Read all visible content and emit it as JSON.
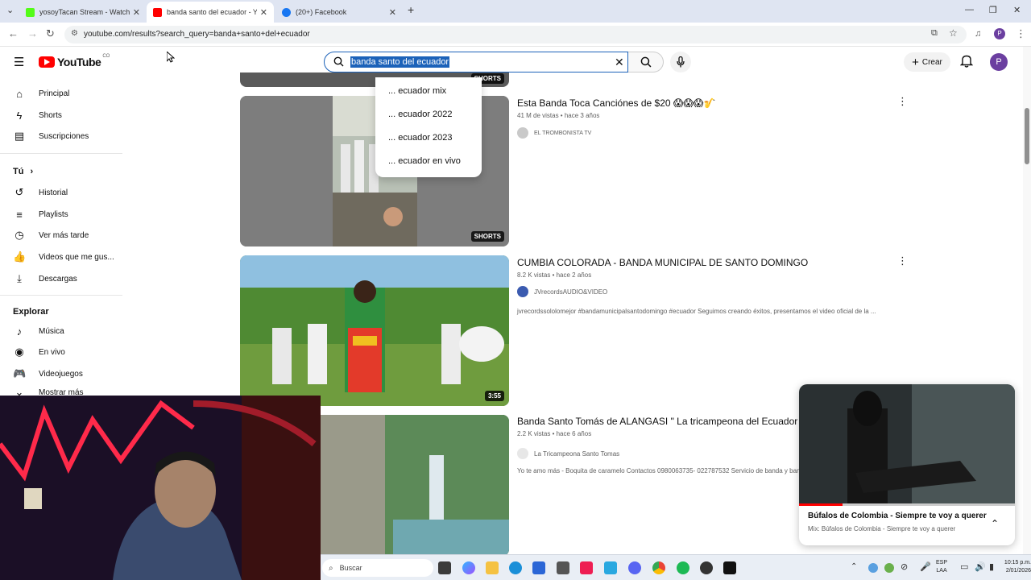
{
  "browser": {
    "tabs": [
      {
        "title": "yosoyTacan Stream - Watch Liv",
        "fav_color": "#53fc18"
      },
      {
        "title": "banda santo del ecuador - You",
        "fav_color": "#ff0000"
      },
      {
        "title": "(20+) Facebook",
        "fav_color": "#1877f2"
      }
    ],
    "url": "youtube.com/results?search_query=banda+santo+del+ecuador",
    "profile_initial": "P"
  },
  "youtube": {
    "logo_text": "YouTube",
    "region": "CO",
    "search_query": "banda santo del ecuador",
    "create_label": "Crear",
    "avatar_initial": "P",
    "suggestions": [
      "... ecuador mix",
      "... ecuador 2022",
      "... ecuador 2023",
      "... ecuador en vivo"
    ]
  },
  "sidebar": {
    "main": [
      {
        "label": "Principal",
        "icon": "home-icon"
      },
      {
        "label": "Shorts",
        "icon": "shorts-icon"
      },
      {
        "label": "Suscripciones",
        "icon": "subscriptions-icon"
      }
    ],
    "you_heading": "Tú",
    "you": [
      {
        "label": "Historial",
        "icon": "history-icon"
      },
      {
        "label": "Playlists",
        "icon": "playlists-icon"
      },
      {
        "label": "Ver más tarde",
        "icon": "watch-later-icon"
      },
      {
        "label": "Videos que me gus...",
        "icon": "like-icon"
      },
      {
        "label": "Descargas",
        "icon": "download-icon"
      }
    ],
    "explore_heading": "Explorar",
    "explore": [
      {
        "label": "Música",
        "icon": "music-icon"
      },
      {
        "label": "En vivo",
        "icon": "live-icon"
      },
      {
        "label": "Videojuegos",
        "icon": "gaming-icon"
      }
    ],
    "more_label": "Mostrar más"
  },
  "results": [
    {
      "title": "Esta Banda Toca Canciónes de $20 😱😱😱🎷",
      "meta": "41 M de vistas • hace 3 años",
      "channel": "EL TROMBONISTA TV",
      "badge": "SHORTS",
      "description": ""
    },
    {
      "title": "CUMBIA COLORADA - BANDA MUNICIPAL DE SANTO DOMINGO",
      "meta": "8.2 K vistas • hace 2 años",
      "channel": "JVrecordsAUDIO&VIDEO",
      "badge": "3:55",
      "description": "jvrecordssololomejor #bandamunicipalsantodomingo #ecuador Seguimos creando éxitos, presentamos el video oficial de la ..."
    },
    {
      "title": "Banda Santo Tomás de ALANGASI \" La tricampeona del Ecuador \"",
      "meta": "2.2 K vistas • hace 6 años",
      "channel": "La Tricampeona Santo Tomas",
      "badge": "",
      "description": "Yo te amo más - Boquita de caramelo Contactos 0980063735- 022787532 Servicio de banda y ban"
    }
  ],
  "prev_badge": "SHORTS",
  "miniplayer": {
    "title": "Búfalos de Colombia - Siempre te voy a querer",
    "subtitle": "Mix: Búfalos de Colombia - Siempre te voy a querer",
    "progress": 0.2
  },
  "taskbar": {
    "search_placeholder": "Buscar",
    "lang_top": "ESP",
    "lang_bottom": "LAA",
    "time": "10:15 p.m.",
    "date": "2/01/2026"
  }
}
